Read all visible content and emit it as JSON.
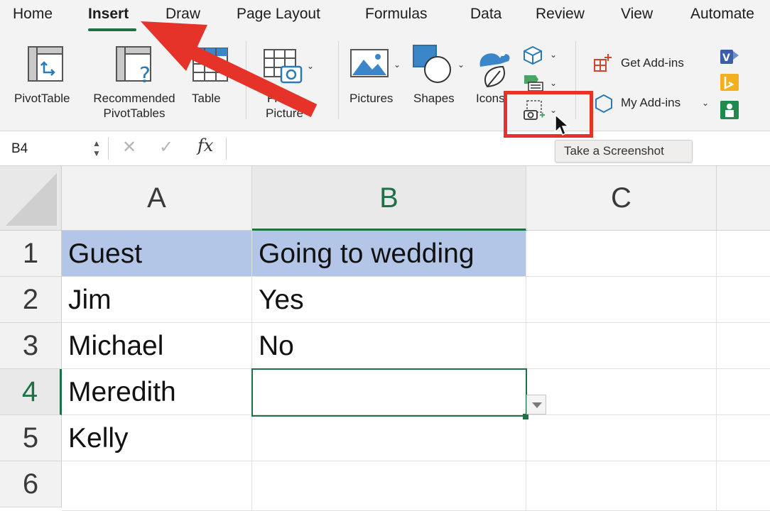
{
  "tabs": [
    "Home",
    "Insert",
    "Draw",
    "Page Layout",
    "Formulas",
    "Data",
    "Review",
    "View",
    "Automate"
  ],
  "active_tab": "Insert",
  "ribbon": {
    "pivottable": "PivotTable",
    "recommended_line1": "Recommended",
    "recommended_line2": "PivotTables",
    "table": "Table",
    "from_picture_line1": "From",
    "from_picture_line2": "Picture",
    "pictures": "Pictures",
    "shapes": "Shapes",
    "icons": "Icons",
    "get_addins": "Get Add-ins",
    "my_addins": "My Add-ins"
  },
  "formula_bar": {
    "name_box": "B4",
    "fx": "fx",
    "content": ""
  },
  "tooltip": "Take a Screenshot",
  "sheet": {
    "columns": [
      "A",
      "B",
      "C"
    ],
    "rows": [
      "1",
      "2",
      "3",
      "4",
      "5",
      "6"
    ],
    "cells": [
      [
        "Guest",
        "Going to wedding",
        ""
      ],
      [
        "Jim",
        "Yes",
        ""
      ],
      [
        "Michael",
        "No",
        ""
      ],
      [
        "Meredith",
        "",
        ""
      ],
      [
        "Kelly",
        "",
        ""
      ],
      [
        "",
        "",
        ""
      ]
    ],
    "selected_cell": "B4"
  },
  "colors": {
    "accent_green": "#1e7145",
    "header_fill": "#b4c6e7",
    "annotation_red": "#e5332a"
  }
}
